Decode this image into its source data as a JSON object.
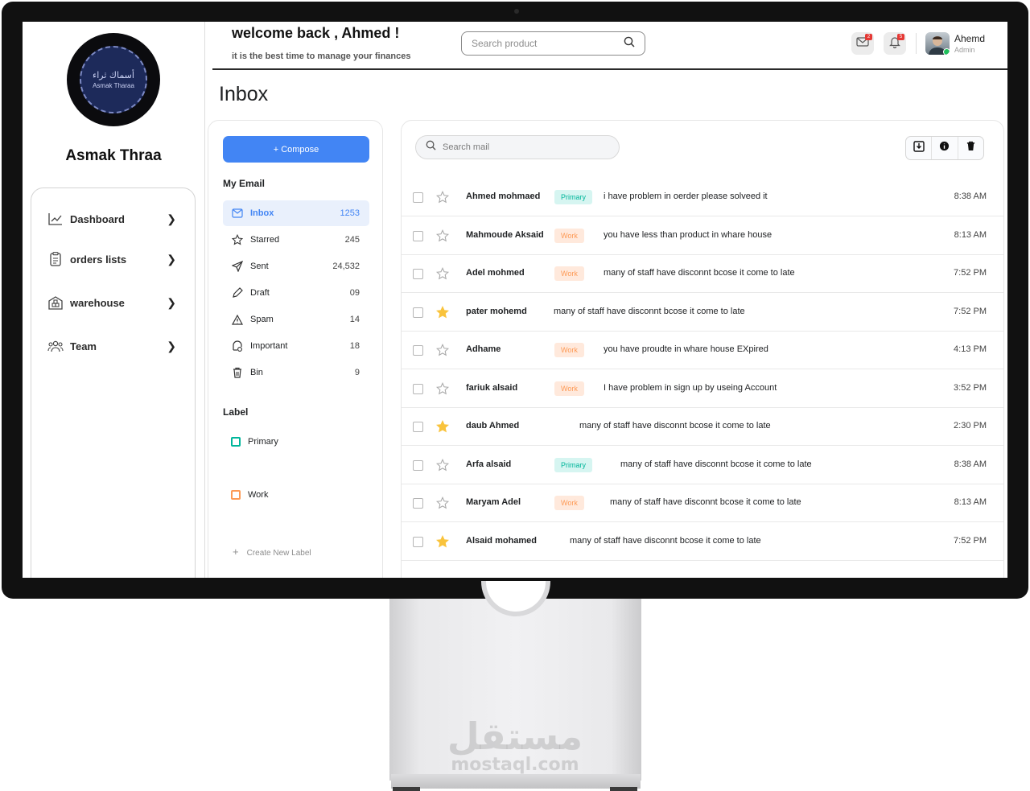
{
  "sidebar": {
    "logo": {
      "arabic": "أسماك ثراء",
      "latin": "Asmak Tharaa"
    },
    "brand": "Asmak Thraa",
    "items": [
      {
        "label": "Dashboard",
        "icon": "chart-line-icon"
      },
      {
        "label": "orders lists",
        "icon": "clipboard-icon"
      },
      {
        "label": "warehouse",
        "icon": "warehouse-icon"
      },
      {
        "label": "Team",
        "icon": "team-icon"
      }
    ]
  },
  "header": {
    "welcome": "welcome back , Ahmed !",
    "tagline": "it is the best time to manage your finances",
    "search_placeholder": "Search product",
    "mail_badge": "2",
    "notification_badge": "5",
    "user_name": "Ahemd",
    "user_role": "Admin"
  },
  "page": {
    "title": "Inbox"
  },
  "folders": {
    "compose": "+ Compose",
    "section_title": "My Email",
    "items": [
      {
        "label": "Inbox",
        "count": "1253",
        "icon": "inbox-icon"
      },
      {
        "label": "Starred",
        "count": "245",
        "icon": "star-icon"
      },
      {
        "label": "Sent",
        "count": "24,532",
        "icon": "send-icon"
      },
      {
        "label": "Draft",
        "count": "09",
        "icon": "pencil-icon"
      },
      {
        "label": "Spam",
        "count": "14",
        "icon": "warning-icon"
      },
      {
        "label": "Important",
        "count": "18",
        "icon": "important-icon"
      },
      {
        "label": "Bin",
        "count": "9",
        "icon": "trash-icon"
      }
    ],
    "label_title": "Label",
    "labels": [
      {
        "label": "Primary",
        "color": "#00b69b"
      },
      {
        "label": "Work",
        "color": "#fd9a56"
      }
    ],
    "create_label": "Create New Label"
  },
  "mail": {
    "search_placeholder": "Search mail",
    "toolbar": [
      "download-icon",
      "info-icon",
      "trash-icon"
    ],
    "rows": [
      {
        "sender": "Ahmed mohmaed",
        "tag": "Primary",
        "subject": "i have problem in oerder please solveed it",
        "time": "8:38 AM",
        "starred": false
      },
      {
        "sender": "Mahmoude Aksaid",
        "tag": "Work",
        "subject": "you have less than product in whare house",
        "time": "8:13 AM",
        "starred": false
      },
      {
        "sender": "Adel mohmed",
        "tag": "Work",
        "subject": "many of staff have disconnt bcose it  come to late",
        "time": "7:52 PM",
        "starred": false
      },
      {
        "sender": "pater mohemd",
        "tag": "",
        "subject": "many of staff have disconnt bcose it  come to late",
        "time": "7:52 PM",
        "starred": true
      },
      {
        "sender": "Adhame",
        "tag": "Work",
        "subject": "you have proudte in whare house  EXpired",
        "time": "4:13 PM",
        "starred": false
      },
      {
        "sender": "fariuk alsaid",
        "tag": "Work",
        "subject": "I have problem in sign up  by useing Account",
        "time": "3:52 PM",
        "starred": false
      },
      {
        "sender": "daub Ahmed",
        "tag": "",
        "subject": "many of staff have disconnt bcose it  come to late",
        "time": "2:30 PM",
        "starred": true
      },
      {
        "sender": "Arfa alsaid",
        "tag": "Primary",
        "subject": "many of staff have disconnt bcose it  come to late",
        "time": "8:38 AM",
        "starred": false
      },
      {
        "sender": "Maryam Adel",
        "tag": "Work",
        "subject": "many of staff have disconnt bcose it  come to late",
        "time": "8:13 AM",
        "starred": false
      },
      {
        "sender": "Alsaid mohamed",
        "tag": "",
        "subject": "many of staff have disconnt bcose it  come to late",
        "time": "7:52 PM",
        "starred": true
      }
    ]
  },
  "watermark": {
    "arabic": "مستقل",
    "latin": "mostaql.com"
  },
  "colors": {
    "accent": "#4285f4",
    "primary_tag": "#00b69b",
    "work_tag": "#fd9a56",
    "star_on": "#f9c33c"
  }
}
